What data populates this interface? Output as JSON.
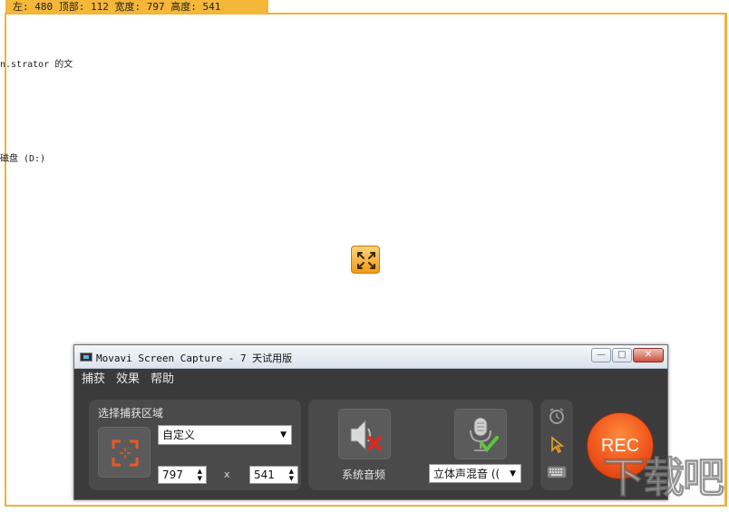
{
  "capture_info": "左: 480  顶部: 112  宽度: 797  高度: 541",
  "desktop": {
    "line1": "n.strator 的文",
    "line2": "磁盘 (D:)"
  },
  "window": {
    "title": "Movavi Screen Capture - 7 天试用版",
    "controls": {
      "minimize": "—",
      "maximize": "□",
      "close": "✕"
    }
  },
  "menu": [
    "捕获",
    "效果",
    "帮助"
  ],
  "area": {
    "label": "选择捕获区域",
    "mode": "自定义",
    "width": "797",
    "height": "541",
    "times": "x"
  },
  "audio": {
    "system_label": "系统音频",
    "mic_source": "立体声混音 (("
  },
  "side_icons": [
    "timer-icon",
    "cursor-icon",
    "keyboard-icon"
  ],
  "rec_label": "REC",
  "watermark": "下载吧",
  "colors": {
    "frame": "#f2b03a",
    "panel": "#4a4a4a",
    "window_bg": "#3b3b3b",
    "rec": "#f0561c",
    "area_icon": "#e8582a"
  }
}
